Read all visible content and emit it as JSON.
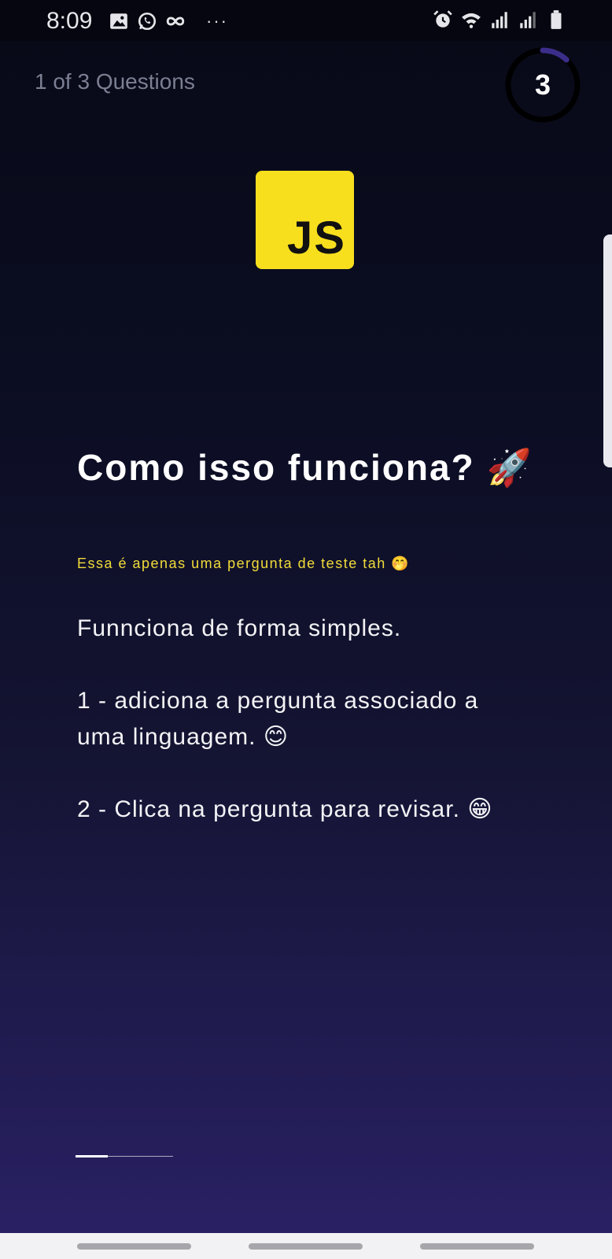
{
  "status_bar": {
    "time": "8:09",
    "left_icons": [
      "image-icon",
      "whatsapp-icon",
      "infinity-icon",
      "more-dots-icon"
    ],
    "right_icons": [
      "alarm-icon",
      "wifi-icon",
      "signal-icon",
      "signal-icon",
      "battery-icon"
    ],
    "more": "···"
  },
  "quiz": {
    "counter": "1 of 3 Questions",
    "timer_value": "3",
    "timer_progress": 0.12,
    "logo_text": "JS",
    "logo_color": "#f7df1e",
    "title": "Como isso funciona? 🚀",
    "subtitle": "Essa é apenas uma pergunta de teste tah 🤭",
    "paragraphs": [
      "Funnciona de forma simples.",
      "1 - adiciona a pergunta associado a uma linguagem. 😊",
      "2 - Clica na pergunta para revisar. 😁"
    ],
    "progress": 0.33
  },
  "colors": {
    "accent": "#f2dc3a",
    "timer_ring": "#3b2e8a",
    "background_top": "#080a17",
    "background_bottom": "#2a2166"
  }
}
